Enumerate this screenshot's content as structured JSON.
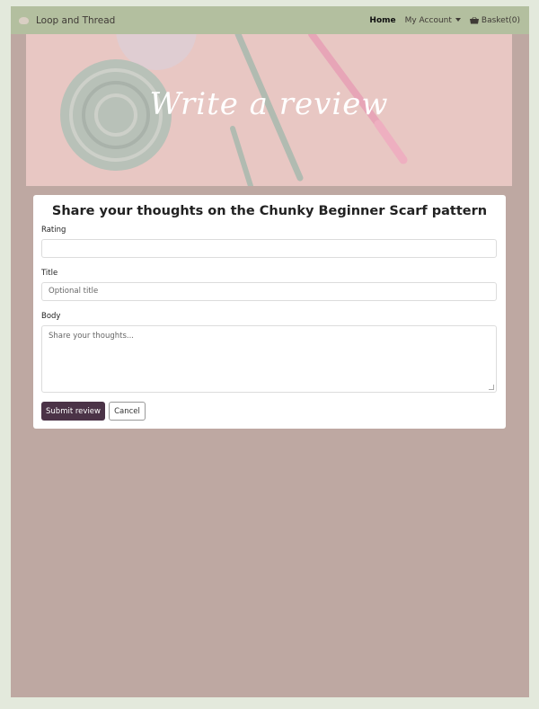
{
  "navbar": {
    "brand": "Loop and Thread",
    "items": [
      {
        "label": "Home"
      },
      {
        "label": "My Account"
      },
      {
        "label": "Basket(0)"
      }
    ]
  },
  "hero": {
    "title": "Write a review"
  },
  "review_form": {
    "heading": "Share your thoughts on the Chunky Beginner Scarf pattern",
    "rating_label": "Rating",
    "rating_value": "",
    "title_label": "Title",
    "title_placeholder": "Optional title",
    "body_label": "Body",
    "body_placeholder": "Share your thoughts...",
    "submit_label": "Submit review",
    "cancel_label": "Cancel"
  },
  "colors": {
    "navbar_bg": "#b3bf9f",
    "page_bg": "#bea8a2",
    "submit_bg": "#4b3347"
  }
}
